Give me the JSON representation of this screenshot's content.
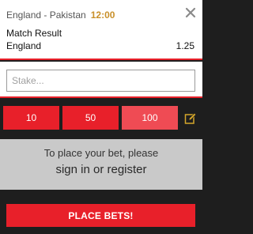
{
  "selection": {
    "event": "England - Pakistan",
    "time": "12:00",
    "market": "Match Result",
    "name": "England",
    "odds": "1.25"
  },
  "stake": {
    "placeholder": "Stake...",
    "value": ""
  },
  "quick_stakes": [
    "10",
    "50",
    "100"
  ],
  "login_prompt": {
    "line1": "To place your bet, please",
    "line2": "sign in or register"
  },
  "place_bets_label": "PLACE BETS!",
  "icons": {
    "close": "close-icon",
    "edit": "edit-icon"
  },
  "colors": {
    "accent": "#e8202a",
    "accent_light": "#ef4b54",
    "time": "#c9902a",
    "dark_bg": "#1e1e1e",
    "prompt_bg": "#c9c9c9"
  }
}
